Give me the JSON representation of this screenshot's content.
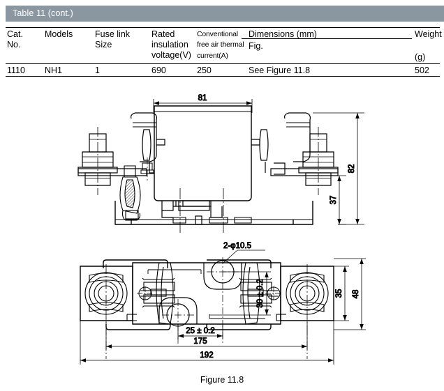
{
  "table": {
    "title": "Table 11 (cont.)",
    "headers": {
      "cat_no": "Cat.\nNo.",
      "models": "Models",
      "fuse_link_size": "Fuse link\nSize",
      "rated_insulation_voltage": "Rated\ninsulation\nvoltage(V)",
      "conventional_current": "Conventional\nfree air thermal\ncurrent(A)",
      "dimensions": "Dimensions (mm)",
      "dimensions_sub": "Fig.",
      "weight": "Weight",
      "weight_unit": "(g)"
    },
    "rows": [
      {
        "cat_no": "1110",
        "models": "NH1",
        "fuse_link_size": "1",
        "rated_insulation_voltage": "690",
        "conventional_current": "250",
        "dimensions": "See Figure 11.8",
        "weight": "502"
      }
    ]
  },
  "figure": {
    "caption": "Figure 11.8",
    "side_view": {
      "dim_width": "81",
      "dim_height_total": "82",
      "dim_height_lower": "37"
    },
    "top_view": {
      "dim_hole": "2-φ10.5",
      "dim_vertical_hole": "30 ± 0.2",
      "dim_horizontal_hole": "25 ± 0.2",
      "dim_length_inner": "175",
      "dim_length_outer": "192",
      "dim_width_inner": "35",
      "dim_width_outer": "48"
    }
  },
  "colors": {
    "title_bar": "#8b97a0",
    "title_text": "#ffffff",
    "line": "#000000",
    "background": "#ffffff"
  }
}
